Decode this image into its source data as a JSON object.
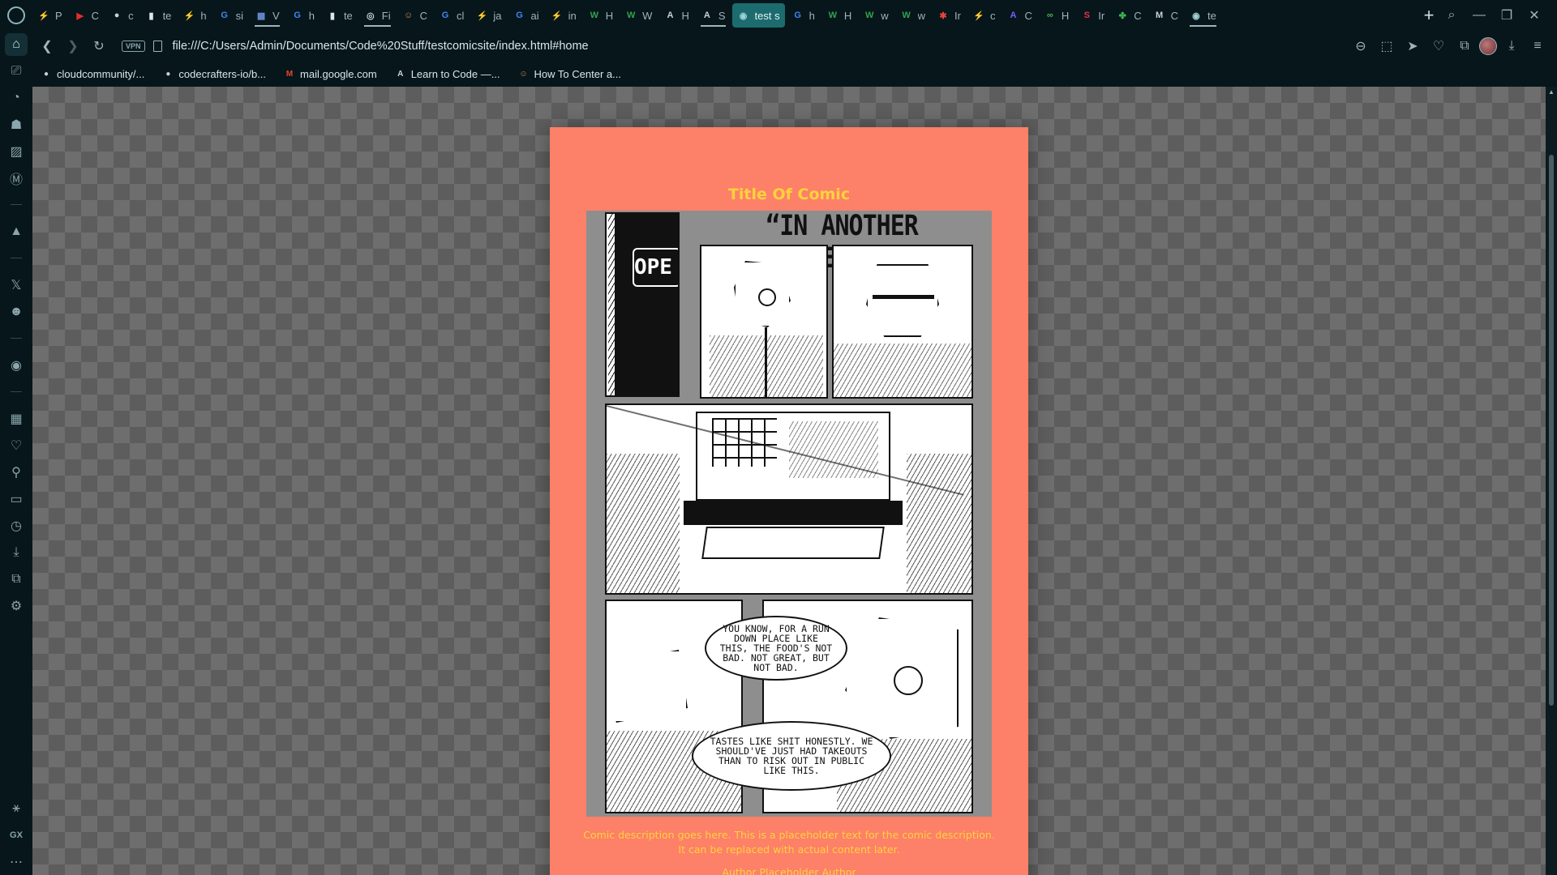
{
  "browser": {
    "tabs": [
      {
        "label": "P",
        "fav": "⚡",
        "color": "#e58a2f"
      },
      {
        "label": "C",
        "fav": "▶",
        "color": "#e52d27"
      },
      {
        "label": "c",
        "fav": "●",
        "color": "#c9d1d9"
      },
      {
        "label": "te",
        "fav": "▮",
        "color": "#dde6e8"
      },
      {
        "label": "h",
        "fav": "⚡",
        "color": "#e58a2f"
      },
      {
        "label": "si",
        "fav": "G",
        "color": "#4285f4"
      },
      {
        "label": "V",
        "fav": "▦",
        "color": "#6a8fd8",
        "underlined": true
      },
      {
        "label": "h",
        "fav": "G",
        "color": "#4285f4"
      },
      {
        "label": "te",
        "fav": "▮",
        "color": "#dde6e8"
      },
      {
        "label": "Fi",
        "fav": "◎",
        "color": "#c9d1d9",
        "underlined": true
      },
      {
        "label": "C",
        "fav": "☺",
        "color": "#d08b5b"
      },
      {
        "label": "cl",
        "fav": "G",
        "color": "#4285f4"
      },
      {
        "label": "ja",
        "fav": "⚡",
        "color": "#e58a2f"
      },
      {
        "label": "ai",
        "fav": "G",
        "color": "#4285f4"
      },
      {
        "label": "in",
        "fav": "⚡",
        "color": "#e58a2f"
      },
      {
        "label": "H",
        "fav": "W",
        "color": "#2ea44f"
      },
      {
        "label": "W",
        "fav": "W",
        "color": "#2ea44f"
      },
      {
        "label": "H",
        "fav": "A",
        "color": "#c9d1d9"
      },
      {
        "label": "S",
        "fav": "A",
        "color": "#c9d1d9",
        "underlined": true
      },
      {
        "label": "test s",
        "fav": "◉",
        "color": "#9fd3d6",
        "active": true
      },
      {
        "label": "h",
        "fav": "G",
        "color": "#4285f4"
      },
      {
        "label": "H",
        "fav": "W",
        "color": "#2ea44f"
      },
      {
        "label": "w",
        "fav": "W",
        "color": "#2ea44f"
      },
      {
        "label": "w",
        "fav": "W",
        "color": "#2ea44f"
      },
      {
        "label": "Ir",
        "fav": "✱",
        "color": "#e8453c"
      },
      {
        "label": "c",
        "fav": "⚡",
        "color": "#e58a2f"
      },
      {
        "label": "C",
        "fav": "A",
        "color": "#7c5cff"
      },
      {
        "label": "H",
        "fav": "∞",
        "color": "#3fb950"
      },
      {
        "label": "Ir",
        "fav": "S",
        "color": "#e5304e"
      },
      {
        "label": "C",
        "fav": "✤",
        "color": "#3fb950"
      },
      {
        "label": "C",
        "fav": "M",
        "color": "#c9d1d9"
      },
      {
        "label": "te",
        "fav": "◉",
        "color": "#9fd3d6",
        "current": true
      }
    ],
    "url": "file:///C:/Users/Admin/Documents/Code%20Stuff/testcomicsite/index.html#home",
    "vpn_label": "VPN",
    "bookmarks": [
      {
        "label": "cloudcommunity/...",
        "icon": "●",
        "color": "#c9d1d9"
      },
      {
        "label": "codecrafters-io/b...",
        "icon": "●",
        "color": "#c9d1d9"
      },
      {
        "label": "mail.google.com",
        "icon": "M",
        "color": "#ea4335"
      },
      {
        "label": "Learn to Code —...",
        "icon": "A",
        "color": "#c9d1d9"
      },
      {
        "label": "How To Center a...",
        "icon": "☺",
        "color": "#d08b5b"
      }
    ],
    "sidebar_bottom": {
      "gx": "GX"
    }
  },
  "page": {
    "title": "Title Of Comic",
    "description": "Comic description goes here. This is a placeholder text for the comic description. It can be replaced with actual content later.",
    "author": "Author Placeholder Author",
    "comic": {
      "headline": "“IN ANOTHER LIFETIME”",
      "sign": "OPE",
      "bubble_1": "YOU KNOW, FOR A RUN DOWN PLACE LIKE THIS, THE FOOD'S NOT BAD. NOT GREAT, BUT NOT BAD.",
      "bubble_2": "TASTES LIKE SHIT HONESTLY. WE SHOULD'VE JUST HAD TAKEOUTS THAN TO RISK OUT IN PUBLIC LIKE THIS."
    }
  },
  "colors": {
    "card_bg": "#fd8069",
    "title_color": "#ffd23a",
    "active_tab": "#1c6b6e"
  }
}
